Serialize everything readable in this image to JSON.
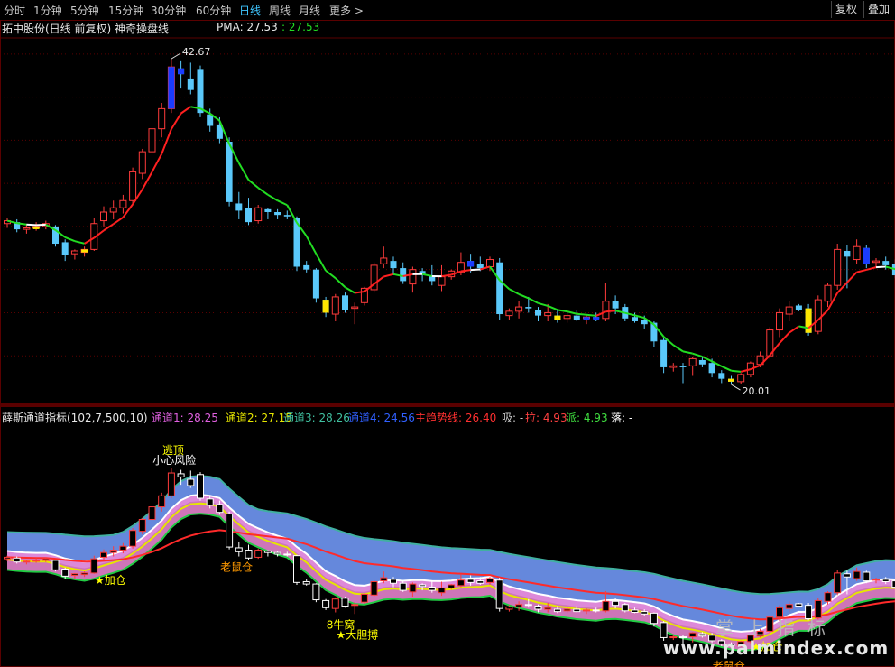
{
  "toolbar": {
    "tabs": [
      {
        "label": "分时",
        "active": false
      },
      {
        "label": "1分钟",
        "active": false
      },
      {
        "label": "5分钟",
        "active": false
      },
      {
        "label": "15分钟",
        "active": false
      },
      {
        "label": "30分钟",
        "active": false
      },
      {
        "label": "60分钟",
        "active": false
      },
      {
        "label": "日线",
        "active": true
      },
      {
        "label": "周线",
        "active": false
      },
      {
        "label": "月线",
        "active": false
      },
      {
        "label": "更多 >",
        "active": false
      }
    ],
    "right_buttons": [
      "复权",
      "叠加"
    ]
  },
  "main_chart": {
    "title": "拓中股份(日线 前复权) 神奇操盘线",
    "indicator_label": "PMA: 27.53",
    "indicator_value": ": 27.53",
    "high_label": "42.67",
    "low_label": "20.01",
    "colors": {
      "up": "#ff3b3b",
      "down": "#5ac8fa",
      "bull_bar": "#ffe600",
      "bear_bar": "#1a3cff",
      "ma_up": "#ff2020",
      "ma_down": "#22dd22",
      "ma_flat": "#ffffff",
      "grid": "#5a0000"
    }
  },
  "sub_chart": {
    "title": "薛斯通道指标(102,7,500,10)",
    "legend": [
      {
        "label": "通道1: 28.25",
        "color": "#e060e0"
      },
      {
        "label": "通道2: 27.15",
        "color": "#e6e600"
      },
      {
        "label": "通道3: 28.26",
        "color": "#40c0a0"
      },
      {
        "label": "通道4: 24.56",
        "color": "#3060ff"
      },
      {
        "label": "主趋势线: 26.40",
        "color": "#ff3030"
      },
      {
        "label": "吸: -",
        "color": "#c8c8c8"
      },
      {
        "label": "拉: 4.93",
        "color": "#ff4040"
      },
      {
        "label": "派: 4.93",
        "color": "#40e040"
      },
      {
        "label": "落: -",
        "color": "#ffffff"
      }
    ],
    "annotations": [
      {
        "text": "小心风险",
        "color": "#ffffff"
      },
      {
        "text": "逃顶",
        "color": "#ffff00"
      },
      {
        "text": "★加仓",
        "color": "#ffff00"
      },
      {
        "text": "老鼠仓",
        "color": "#ff9900"
      },
      {
        "text": "8牛窝",
        "color": "#ffff00"
      },
      {
        "text": "★大胆搏",
        "color": "#ffff00"
      },
      {
        "text": "老鼠仓",
        "color": "#ff9900"
      },
      {
        "text": "★加仓",
        "color": "#ffff00"
      }
    ]
  },
  "watermark": {
    "line1": "掌上指标",
    "line2": "www.palmindex.com"
  },
  "chart_data": {
    "type": "candlestick",
    "series": [
      {
        "name": "",
        "ohlc": [
          [
            31.2,
            31.6,
            30.9,
            31.4
          ],
          [
            31.3,
            31.5,
            30.6,
            30.8
          ],
          [
            30.8,
            31.1,
            30.5,
            30.9
          ],
          [
            30.9,
            31.3,
            30.7,
            31.0
          ],
          [
            31.0,
            31.4,
            30.8,
            31.2
          ],
          [
            31.0,
            31.1,
            29.6,
            29.8
          ],
          [
            29.9,
            30.1,
            28.6,
            29.0
          ],
          [
            29.1,
            29.4,
            28.7,
            29.3
          ],
          [
            29.2,
            29.6,
            28.9,
            29.4
          ],
          [
            29.4,
            31.6,
            29.3,
            31.2
          ],
          [
            31.4,
            32.4,
            31.0,
            32.0
          ],
          [
            32.0,
            32.8,
            31.5,
            32.3
          ],
          [
            32.3,
            33.2,
            31.9,
            32.8
          ],
          [
            32.8,
            35.1,
            32.5,
            34.8
          ],
          [
            34.7,
            36.4,
            34.3,
            36.2
          ],
          [
            36.2,
            38.3,
            35.9,
            37.8
          ],
          [
            37.8,
            39.6,
            37.2,
            39.2
          ],
          [
            39.2,
            42.67,
            38.9,
            42.1
          ],
          [
            42.0,
            42.5,
            40.6,
            41.6
          ],
          [
            41.3,
            42.4,
            40.2,
            40.5
          ],
          [
            41.9,
            42.2,
            38.6,
            38.9
          ],
          [
            38.8,
            39.2,
            37.6,
            38.0
          ],
          [
            38.1,
            38.6,
            36.8,
            37.1
          ],
          [
            36.9,
            37.2,
            32.4,
            32.7
          ],
          [
            32.6,
            33.4,
            31.5,
            32.1
          ],
          [
            32.3,
            33.0,
            31.1,
            31.3
          ],
          [
            31.4,
            32.5,
            31.2,
            32.3
          ],
          [
            32.2,
            32.3,
            31.5,
            32.0
          ],
          [
            32.0,
            32.2,
            31.5,
            31.8
          ],
          [
            31.8,
            32.1,
            31.5,
            31.7
          ],
          [
            31.6,
            31.7,
            27.9,
            28.2
          ],
          [
            28.3,
            28.6,
            27.8,
            28.0
          ],
          [
            28.0,
            28.1,
            25.7,
            26.0
          ],
          [
            25.9,
            26.1,
            24.7,
            25.0
          ],
          [
            24.9,
            26.3,
            24.4,
            26.1
          ],
          [
            26.2,
            26.4,
            25.0,
            25.2
          ],
          [
            25.3,
            25.7,
            24.2,
            25.4
          ],
          [
            25.7,
            26.8,
            25.5,
            26.7
          ],
          [
            26.6,
            28.5,
            26.4,
            28.3
          ],
          [
            28.4,
            29.6,
            28.1,
            28.8
          ],
          [
            28.6,
            28.9,
            27.6,
            28.1
          ],
          [
            28.1,
            28.5,
            27.0,
            27.2
          ],
          [
            27.0,
            28.2,
            26.4,
            28.0
          ],
          [
            27.9,
            28.1,
            27.2,
            27.7
          ],
          [
            27.6,
            28.3,
            26.9,
            27.2
          ],
          [
            26.9,
            28.3,
            26.5,
            27.5
          ],
          [
            27.5,
            28.0,
            27.3,
            27.9
          ],
          [
            27.8,
            29.2,
            27.6,
            28.5
          ],
          [
            28.6,
            29.1,
            27.8,
            28.2
          ],
          [
            28.4,
            28.9,
            27.9,
            28.1
          ],
          [
            28.2,
            28.9,
            27.9,
            28.7
          ],
          [
            28.5,
            28.8,
            24.5,
            24.9
          ],
          [
            24.8,
            25.3,
            24.5,
            25.1
          ],
          [
            25.1,
            25.8,
            24.6,
            25.4
          ],
          [
            25.4,
            26.1,
            25.0,
            25.3
          ],
          [
            25.2,
            25.4,
            24.4,
            24.8
          ],
          [
            24.8,
            25.6,
            24.4,
            25.0
          ],
          [
            24.8,
            25.2,
            24.3,
            24.5
          ],
          [
            24.6,
            25.1,
            24.3,
            24.8
          ],
          [
            24.8,
            25.2,
            24.4,
            24.5
          ],
          [
            24.6,
            24.9,
            24.2,
            24.7
          ],
          [
            24.7,
            25.0,
            24.4,
            24.6
          ],
          [
            24.6,
            27.1,
            24.4,
            25.8
          ],
          [
            25.8,
            26.2,
            24.9,
            25.3
          ],
          [
            25.4,
            25.6,
            24.4,
            24.6
          ],
          [
            24.7,
            25.0,
            24.3,
            24.4
          ],
          [
            24.5,
            24.8,
            23.9,
            24.2
          ],
          [
            24.3,
            24.4,
            22.6,
            23.0
          ],
          [
            23.1,
            23.3,
            20.8,
            21.2
          ],
          [
            21.2,
            21.5,
            20.9,
            21.3
          ],
          [
            21.3,
            21.5,
            20.1,
            21.2
          ],
          [
            21.3,
            21.9,
            20.6,
            21.8
          ],
          [
            21.7,
            21.9,
            21.2,
            21.4
          ],
          [
            21.5,
            21.8,
            20.5,
            20.8
          ],
          [
            20.8,
            21.0,
            20.1,
            20.4
          ],
          [
            20.4,
            20.6,
            20.0,
            20.2
          ],
          [
            20.2,
            20.8,
            20.01,
            20.7
          ],
          [
            20.7,
            21.6,
            20.5,
            21.5
          ],
          [
            21.4,
            22.3,
            21.2,
            22.0
          ],
          [
            22.0,
            24.0,
            21.8,
            23.8
          ],
          [
            23.8,
            25.3,
            23.3,
            25.0
          ],
          [
            24.9,
            25.8,
            24.4,
            25.4
          ],
          [
            25.5,
            25.6,
            25.1,
            25.2
          ],
          [
            25.3,
            25.6,
            23.4,
            23.6
          ],
          [
            23.7,
            26.2,
            23.5,
            25.9
          ],
          [
            25.8,
            27.1,
            25.4,
            26.9
          ],
          [
            26.9,
            29.8,
            26.6,
            29.4
          ],
          [
            29.3,
            29.7,
            26.7,
            28.9
          ],
          [
            28.7,
            30.1,
            28.4,
            29.6
          ],
          [
            29.5,
            29.7,
            28.1,
            28.4
          ],
          [
            28.5,
            28.8,
            28.1,
            28.6
          ],
          [
            28.6,
            28.9,
            28.0,
            28.3
          ],
          [
            28.4,
            28.7,
            27.4,
            27.6
          ]
        ]
      }
    ],
    "ylim": [
      19.5,
      44.5
    ],
    "xlabel": "",
    "ylabel": ""
  }
}
